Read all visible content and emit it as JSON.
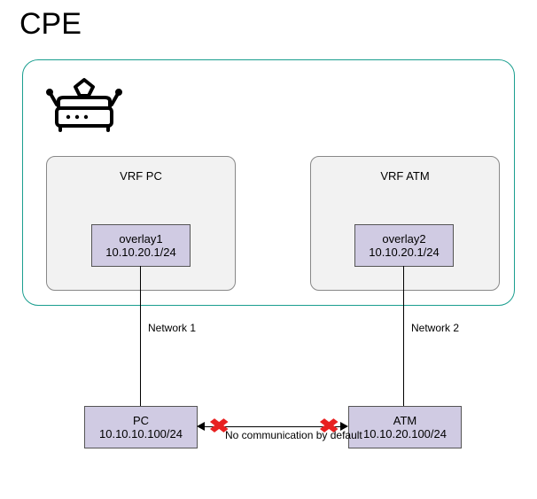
{
  "title": "CPE",
  "vrf_pc": {
    "label": "VRF PC",
    "overlay_name": "overlay1",
    "overlay_ip": "10.10.20.1/24"
  },
  "vrf_atm": {
    "label": "VRF ATM",
    "overlay_name": "overlay2",
    "overlay_ip": "10.10.20.1/24"
  },
  "net1_label": "Network 1",
  "net2_label": "Network 2",
  "pc": {
    "name": "PC",
    "ip": "10.10.10.100/24"
  },
  "atm": {
    "name": "ATM",
    "ip": "10.10.20.100/24"
  },
  "no_comm": "No communication by default"
}
